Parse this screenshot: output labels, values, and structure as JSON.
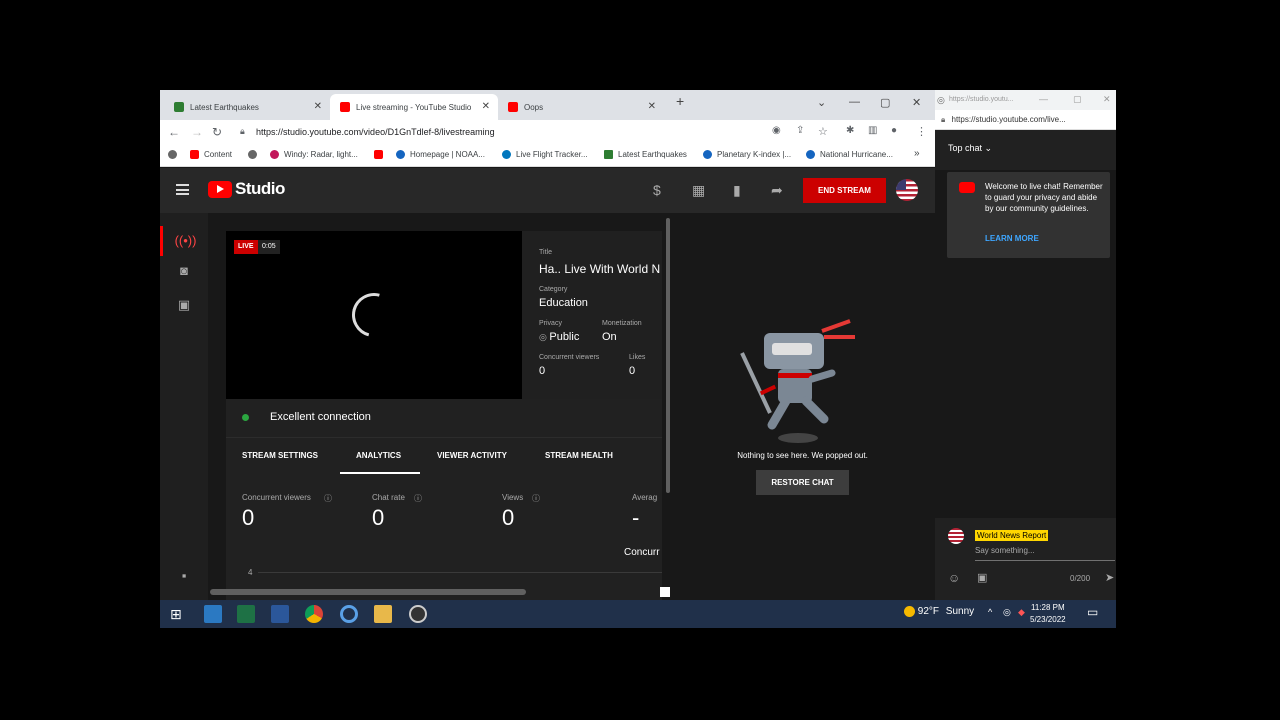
{
  "browser": {
    "tabs": [
      {
        "title": "Latest Earthquakes"
      },
      {
        "title": "Live streaming - YouTube Studio"
      },
      {
        "title": "Oops"
      }
    ],
    "url": "https://studio.youtube.com/video/D1GnTdlef-8/livestreaming",
    "bookmarks": [
      "Content",
      "Windy: Radar, light...",
      "Homepage | NOAA...",
      "Live Flight Tracker...",
      "Latest Earthquakes",
      "Planetary K-index |...",
      "National Hurricane..."
    ]
  },
  "studio": {
    "brand": "Studio",
    "end_stream_label": "END STREAM",
    "preview": {
      "live_label": "LIVE",
      "elapsed": "0:05"
    },
    "info": {
      "title_label": "Title",
      "title": "Ha.. Live With World N",
      "category_label": "Category",
      "category": "Education",
      "privacy_label": "Privacy",
      "privacy": "Public",
      "monetization_label": "Monetization",
      "monetization": "On",
      "viewers_label": "Concurrent viewers",
      "viewers": "0",
      "likes_label": "Likes",
      "likes": "0"
    },
    "connection": "Excellent connection",
    "tabs": [
      "STREAM SETTINGS",
      "ANALYTICS",
      "VIEWER ACTIVITY",
      "STREAM HEALTH"
    ],
    "active_tab": "ANALYTICS",
    "metrics": [
      {
        "label": "Concurrent viewers",
        "value": "0"
      },
      {
        "label": "Chat rate",
        "value": "0"
      },
      {
        "label": "Views",
        "value": "0"
      },
      {
        "label": "Averag",
        "value": "-",
        "sub": "Concurr"
      }
    ],
    "axis_tick": "4",
    "chat_hidden_text": "Nothing to see here. We popped out.",
    "restore_chat_label": "RESTORE CHAT"
  },
  "chat_window": {
    "title": "https://studio.youtu...",
    "url": "https://studio.youtube.com/live...",
    "mode": "Top chat",
    "welcome": "Welcome to live chat! Remember to guard your privacy and abide by our community guidelines.",
    "learn_more": "LEARN MORE",
    "username": "World News Report",
    "placeholder": "Say something...",
    "char_count": "0/200"
  },
  "taskbar": {
    "temperature": "92°F",
    "weather": "Sunny",
    "time": "11:28 PM",
    "date": "5/23/2022"
  },
  "colors": {
    "accent": "#cc0000",
    "link": "#3ea6ff",
    "connection_ok": "#2ba640",
    "chat_user_badge": "#ffd600"
  }
}
